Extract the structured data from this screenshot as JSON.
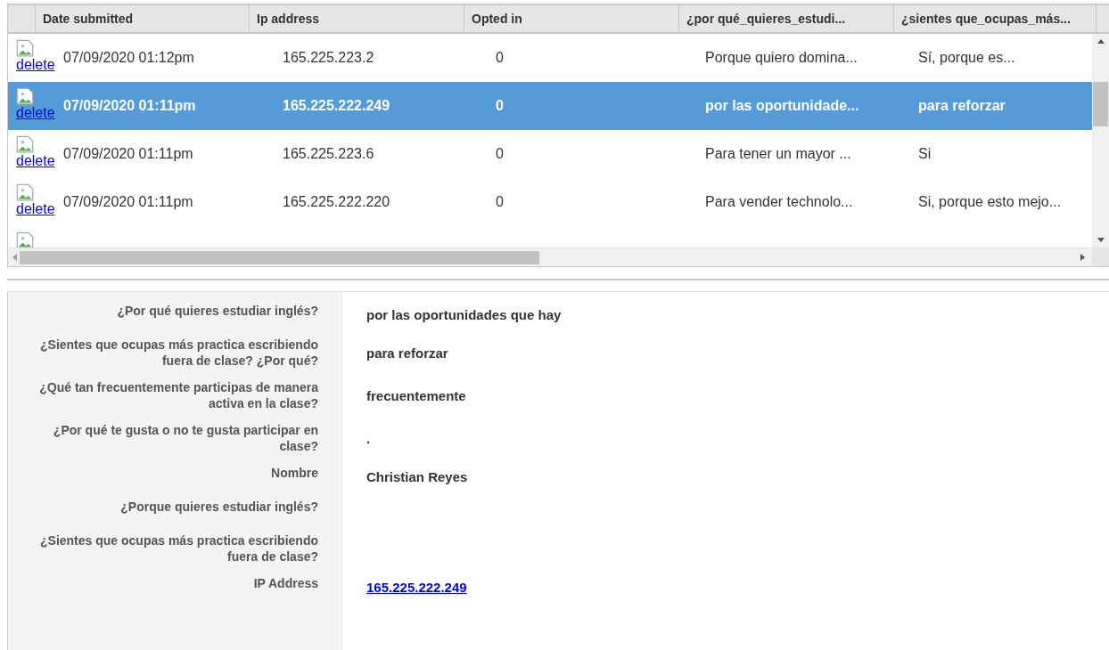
{
  "table": {
    "columns": [
      "Date submitted",
      "Ip address",
      "Opted in",
      "¿por qué_quieres_estudi...",
      "¿sientes que_ocupas_más..."
    ],
    "rows": [
      {
        "link": "delete",
        "cells": [
          "07/09/2020 01:12pm",
          "165.225.223.2",
          "0",
          "Porque quiero domina...",
          "Sí, porque es..."
        ],
        "selected": false
      },
      {
        "link": "delete",
        "cells": [
          "07/09/2020 01:11pm",
          "165.225.222.249",
          "0",
          "por las oportunidade...",
          "para reforzar"
        ],
        "selected": true
      },
      {
        "link": "delete",
        "cells": [
          "07/09/2020 01:11pm",
          "165.225.223.6",
          "0",
          "Para tener un mayor ...",
          "Si"
        ],
        "selected": false
      },
      {
        "link": "delete",
        "cells": [
          "07/09/2020 01:11pm",
          "165.225.222.220",
          "0",
          "Para vender technolo...",
          "Si, porque esto mejo..."
        ],
        "selected": false
      }
    ]
  },
  "details": [
    {
      "label": "¿Por qué quieres estudiar inglés?",
      "value": "por las oportunidades que hay"
    },
    {
      "label": "¿Sientes que ocupas más practica escribiendo fuera de clase? ¿Por qué?",
      "value": "para reforzar"
    },
    {
      "label": "¿Qué tan frecuentemente participas de manera activa en la clase?",
      "value": "frecuentemente"
    },
    {
      "label": "¿Por qué te gusta o no te gusta participar en clase?",
      "value": "."
    },
    {
      "label": "Nombre",
      "value": "Christian Reyes"
    },
    {
      "label": "¿Porque quieres estudiar inglés?"
    },
    {
      "label": "¿Sientes que ocupas más practica escribiendo fuera de clase?"
    },
    {
      "label": "IP Address",
      "value": "165.225.222.249",
      "kind": "link"
    }
  ]
}
